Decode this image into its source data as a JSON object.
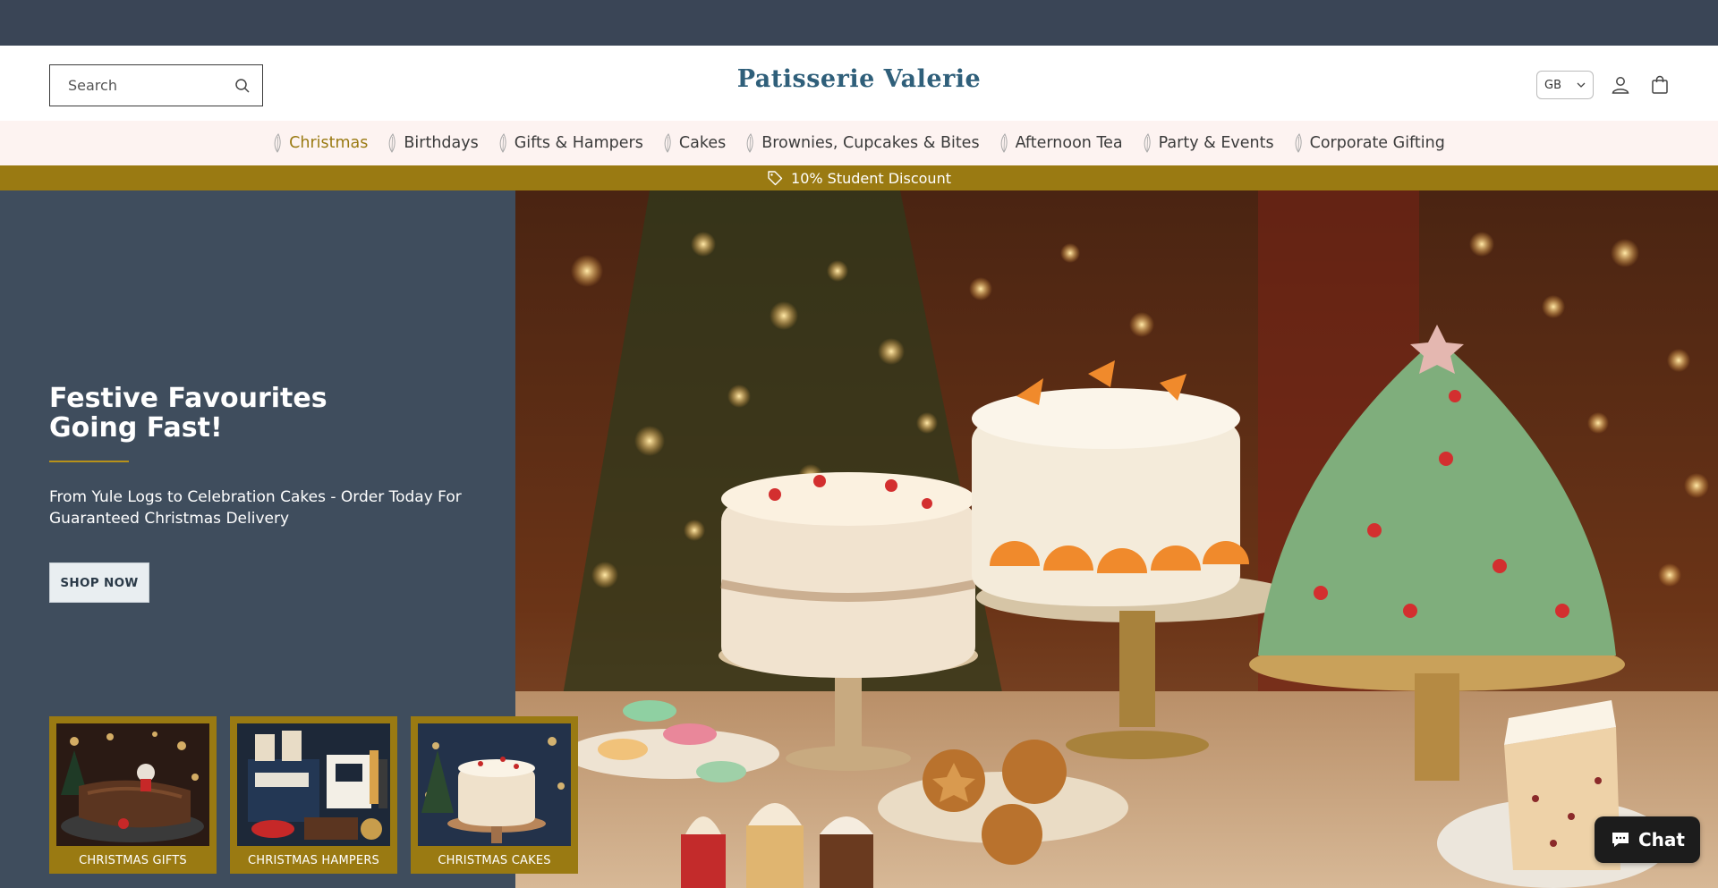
{
  "header": {
    "search_placeholder": "Search",
    "logo": "Patisserie Valerie",
    "country": "GB"
  },
  "nav": {
    "items": [
      {
        "label": "Christmas",
        "active": true
      },
      {
        "label": "Birthdays"
      },
      {
        "label": "Gifts & Hampers"
      },
      {
        "label": "Cakes"
      },
      {
        "label": "Brownies, Cupcakes & Bites"
      },
      {
        "label": "Afternoon Tea"
      },
      {
        "label": "Party & Events"
      },
      {
        "label": "Corporate Gifting"
      }
    ]
  },
  "promo": {
    "text": "10% Student Discount"
  },
  "hero": {
    "headline_line1": "Festive Favourites",
    "headline_line2": "Going Fast!",
    "subtext": "From Yule Logs to Celebration Cakes - Order Today For Guaranteed Christmas Delivery",
    "button": "SHOP NOW"
  },
  "tiles": [
    {
      "label": "CHRISTMAS GIFTS"
    },
    {
      "label": "CHRISTMAS HAMPERS"
    },
    {
      "label": "CHRISTMAS CAKES"
    }
  ],
  "chat": {
    "label": "Chat"
  },
  "colors": {
    "top_strip": "#3a4556",
    "nav_background": "#fdf3f1",
    "accent_gold": "#9a7a12",
    "hero_panel": "#3f4d5d",
    "logo_blue": "#2f5f7a"
  }
}
